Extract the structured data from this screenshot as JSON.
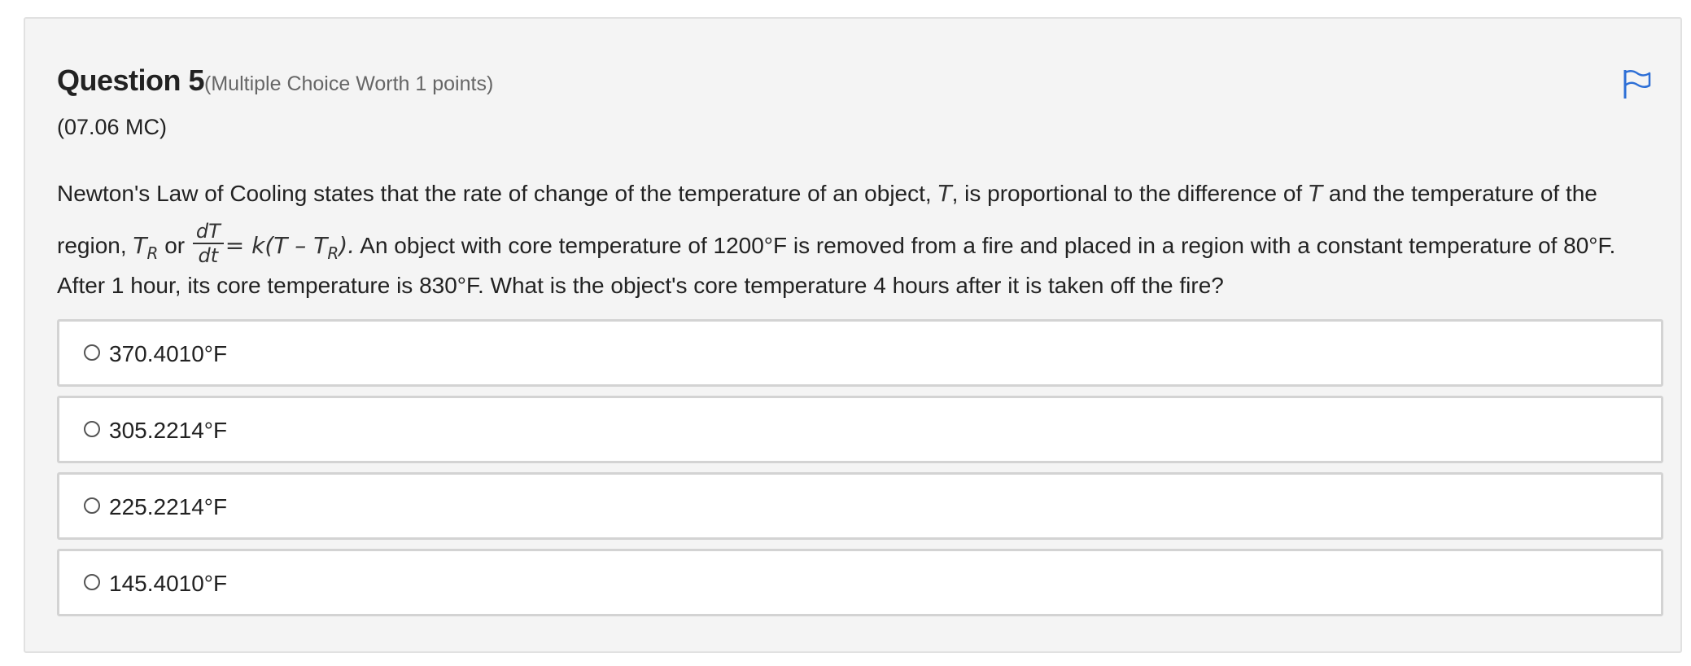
{
  "question": {
    "title": "Question 5",
    "meta": "(Multiple Choice Worth 1 points)",
    "code": "(07.06 MC)",
    "stem": {
      "line1": {
        "text_a": "Newton's Law of Cooling states that the rate of change of the temperature of an object, ",
        "var_t1": "T",
        "text_b": ", is proportional to the difference of ",
        "var_t2": "T",
        "text_c": " and the temperature of the"
      },
      "line2": {
        "text_a": "region, ",
        "var_tr": "T",
        "sub_r": "R",
        "text_or": " or ",
        "frac_num": "dT",
        "frac_den": "dt",
        "equation_a": "= k(T – T",
        "equation_sub": "R",
        "equation_b": ").",
        "text_b": " An object with core temperature of 1200°F is removed from a fire and placed in a region with a constant temperature of 80°F."
      },
      "line3": "After 1 hour, its core temperature is 830°F. What is the object's core temperature 4 hours after it is taken off the fire?"
    },
    "options": [
      {
        "label": "370.4010°F"
      },
      {
        "label": "305.2214°F"
      },
      {
        "label": "225.2214°F"
      },
      {
        "label": "145.4010°F"
      }
    ]
  },
  "icons": {
    "flag": "flag-icon",
    "radio": "radio-button-icon"
  },
  "colors": {
    "card_background": "#f4f4f4",
    "flag_blue": "#2d6fd6",
    "option_border": "#d3d3d3"
  }
}
